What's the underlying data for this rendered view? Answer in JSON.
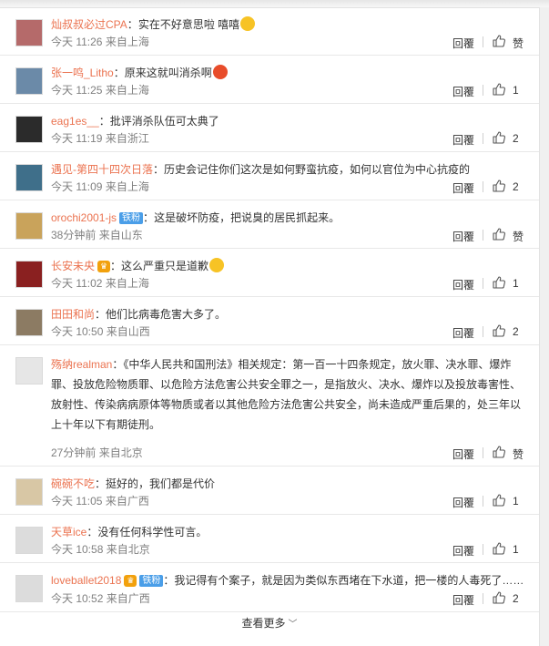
{
  "comments": [
    {
      "user": "灿叔叔必过CPA",
      "text": "实在不好意思啦 嘻嘻",
      "time": "今天 11:26",
      "from": "来自上海",
      "reply": "回覆",
      "likes": "赞",
      "avatar_color": "#b56a6a",
      "emoji": "grin-emoji",
      "emoji_color": "#f7c325"
    },
    {
      "user": "张一鸣_Litho",
      "text": "原来这就叫消杀啊",
      "time": "今天 11:25",
      "from": "来自上海",
      "reply": "回覆",
      "likes": "1",
      "avatar_color": "#6b8aa8",
      "emoji": "angry-emoji",
      "emoji_color": "#e84c2a"
    },
    {
      "user": "eag1es__",
      "text": "批评消杀队伍可太典了",
      "time": "今天 11:19",
      "from": "来自浙江",
      "reply": "回覆",
      "likes": "2",
      "avatar_color": "#2b2b2b"
    },
    {
      "user": "遇见-第四十四次日落",
      "text": "历史会记住你们这次是如何野蛮抗疫，如何以官位为中心抗疫的",
      "time": "今天 11:09",
      "from": "来自上海",
      "reply": "回覆",
      "likes": "2",
      "avatar_color": "#3f6f8a"
    },
    {
      "user": "orochi2001-js",
      "badge": "铁粉",
      "text": "这是破坏防疫，把说臭的居民抓起来。",
      "time": "38分钟前",
      "from": "来自山东",
      "reply": "回覆",
      "likes": "赞",
      "avatar_color": "#c9a35b"
    },
    {
      "user": "长安未央",
      "crown": true,
      "text": "这么严重只是道歉",
      "time": "今天 11:02",
      "from": "来自上海",
      "reply": "回覆",
      "likes": "1",
      "avatar_color": "#8a2020",
      "emoji": "smirk-emoji",
      "emoji_color": "#f7c325"
    },
    {
      "user": "田田和尚",
      "text": "他们比病毒危害大多了。",
      "time": "今天 10:50",
      "from": "来自山西",
      "reply": "回覆",
      "likes": "2",
      "avatar_color": "#8c7b63"
    },
    {
      "user": "殇纳realman",
      "text": "《中华人民共和国刑法》相关规定：第一百一十四条规定，放火罪、决水罪、爆炸罪、投放危险物质罪、以危险方法危害公共安全罪之一，是指放火、决水、爆炸以及投放毒害性、放射性、传染病病原体等物质或者以其他危险方法危害公共安全，尚未造成严重后果的，处三年以上十年以下有期徒刑。",
      "time": "27分钟前",
      "from": "来自北京",
      "reply": "回覆",
      "likes": "赞",
      "avatar_color": "#e6e6e6"
    },
    {
      "user": "碗碗不吃",
      "text": "挺好的，我们都是代价",
      "time": "今天 11:05",
      "from": "来自广西",
      "reply": "回覆",
      "likes": "1",
      "avatar_color": "#d8c7a5"
    },
    {
      "user": "天草ice",
      "text": "没有任何科学性可言。",
      "time": "今天 10:58",
      "from": "来自北京",
      "reply": "回覆",
      "likes": "1",
      "avatar_color": "#dcdcdc"
    },
    {
      "user": "loveballet2018",
      "crown": true,
      "badge": "铁粉",
      "text": "我记得有个案子，就是因为类似东西堵在下水道，把一楼的人毒死了……",
      "time": "今天 10:52",
      "from": "来自广西",
      "reply": "回覆",
      "likes": "2",
      "avatar_color": "#dcdcdc"
    }
  ],
  "more_label": "查看更多",
  "colors": {
    "username": "#eb7350",
    "meta": "#808080",
    "badge": "#4a9ee8"
  }
}
